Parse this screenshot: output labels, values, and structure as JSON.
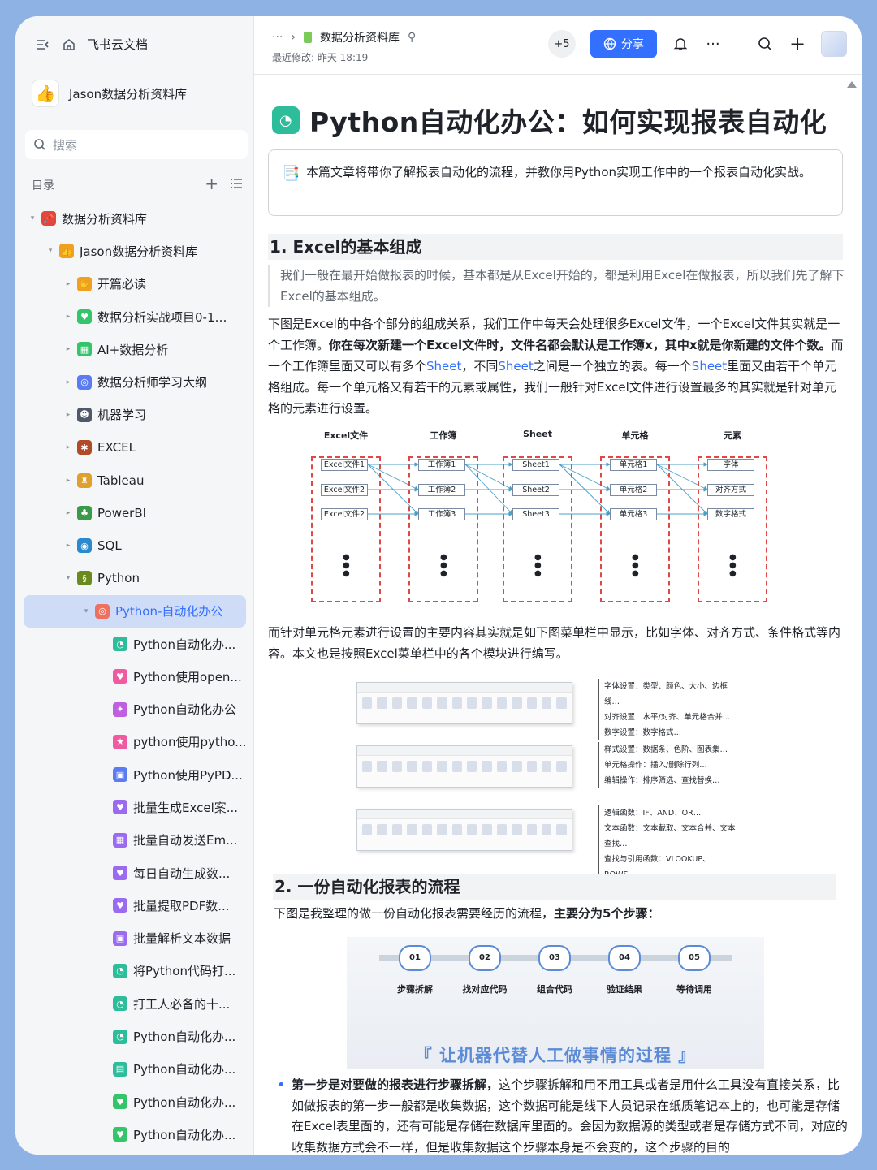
{
  "app": {
    "title": "飞书云文档"
  },
  "sidebar": {
    "space_name": "Jason数据分析资料库",
    "search_placeholder": "搜索",
    "toc_label": "目录",
    "items": [
      {
        "label": "数据分析资料库",
        "level": 0,
        "arrow": "▾",
        "icon": "pin-icon",
        "color": "#e0473e",
        "glyph": "📌"
      },
      {
        "label": "Jason数据分析资料库",
        "level": 1,
        "arrow": "▾",
        "icon": "thumbs-up-icon",
        "color": "#f0a020",
        "glyph": "👍"
      },
      {
        "label": "开篇必读",
        "level": 2,
        "arrow": "▸",
        "icon": "hand-icon",
        "color": "#f0a020",
        "glyph": "✋"
      },
      {
        "label": "数据分析实战项目0-1搭...",
        "level": 2,
        "arrow": "▸",
        "icon": "heart-doc-icon",
        "color": "#34c46a",
        "glyph": "♥"
      },
      {
        "label": "AI+数据分析",
        "level": 2,
        "arrow": "▸",
        "icon": "grid-doc-icon",
        "color": "#34c46a",
        "glyph": "▦"
      },
      {
        "label": "数据分析师学习大纲",
        "level": 2,
        "arrow": "▸",
        "icon": "target-doc-icon",
        "color": "#5b7cf0",
        "glyph": "◎"
      },
      {
        "label": "机器学习",
        "level": 2,
        "arrow": "▸",
        "icon": "robot-icon",
        "color": "#4e5969",
        "glyph": "☻"
      },
      {
        "label": "EXCEL",
        "level": 2,
        "arrow": "▸",
        "icon": "bug-icon",
        "color": "#b24a2a",
        "glyph": "✱"
      },
      {
        "label": "Tableau",
        "level": 2,
        "arrow": "▸",
        "icon": "castle-icon",
        "color": "#e0a030",
        "glyph": "♜"
      },
      {
        "label": "PowerBI",
        "level": 2,
        "arrow": "▸",
        "icon": "palm-tree-icon",
        "color": "#3a9a4a",
        "glyph": "♣"
      },
      {
        "label": "SQL",
        "level": 2,
        "arrow": "▸",
        "icon": "globe-icon",
        "color": "#2a8ad0",
        "glyph": "◉"
      },
      {
        "label": "Python",
        "level": 2,
        "arrow": "▾",
        "icon": "snake-icon",
        "color": "#6a8a20",
        "glyph": "§"
      },
      {
        "label": "Python-自动化办公",
        "level": 3,
        "arrow": "▾",
        "icon": "target-doc-icon",
        "color": "#f07060",
        "glyph": "◎",
        "active": true
      },
      {
        "label": "Python自动化办...",
        "level": 4,
        "arrow": "",
        "icon": "gauge-doc-icon",
        "color": "#2dbd9b",
        "glyph": "◔"
      },
      {
        "label": "Python使用open...",
        "level": 4,
        "arrow": "",
        "icon": "heart-doc-icon",
        "color": "#f05aa0",
        "glyph": "♥"
      },
      {
        "label": "Python自动化办公",
        "level": 4,
        "arrow": "",
        "icon": "sparkle-doc-icon",
        "color": "#c060e0",
        "glyph": "✦"
      },
      {
        "label": "python使用pytho...",
        "level": 4,
        "arrow": "",
        "icon": "star-doc-icon",
        "color": "#f05aa0",
        "glyph": "★"
      },
      {
        "label": "Python使用PyPD...",
        "level": 4,
        "arrow": "",
        "icon": "image-doc-icon",
        "color": "#5b7cf0",
        "glyph": "▣"
      },
      {
        "label": "批量生成Excel案...",
        "level": 4,
        "arrow": "",
        "icon": "heart-doc-icon",
        "color": "#9a6af0",
        "glyph": "♥"
      },
      {
        "label": "批量自动发送Em...",
        "level": 4,
        "arrow": "",
        "icon": "grid-doc-icon",
        "color": "#9a6af0",
        "glyph": "▦"
      },
      {
        "label": "每日自动生成数...",
        "level": 4,
        "arrow": "",
        "icon": "heart-doc-icon",
        "color": "#9a6af0",
        "glyph": "♥"
      },
      {
        "label": "批量提取PDF数...",
        "level": 4,
        "arrow": "",
        "icon": "heart-doc-icon",
        "color": "#9a6af0",
        "glyph": "♥"
      },
      {
        "label": "批量解析文本数据",
        "level": 4,
        "arrow": "",
        "icon": "image-doc-icon",
        "color": "#9a6af0",
        "glyph": "▣"
      },
      {
        "label": "将Python代码打...",
        "level": 4,
        "arrow": "",
        "icon": "gauge-doc-icon",
        "color": "#2dbd9b",
        "glyph": "◔"
      },
      {
        "label": "打工人必备的十...",
        "level": 4,
        "arrow": "",
        "icon": "gauge-doc-icon",
        "color": "#2dbd9b",
        "glyph": "◔"
      },
      {
        "label": "Python自动化办...",
        "level": 4,
        "arrow": "",
        "icon": "gauge-doc-icon",
        "color": "#2dbd9b",
        "glyph": "◔"
      },
      {
        "label": "Python自动化办...",
        "level": 4,
        "arrow": "",
        "icon": "grid-doc-icon",
        "color": "#2dbd9b",
        "glyph": "▤"
      },
      {
        "label": "Python自动化办...",
        "level": 4,
        "arrow": "",
        "icon": "heart-doc-icon",
        "color": "#34c46a",
        "glyph": "♥"
      },
      {
        "label": "Python自动化办...",
        "level": 4,
        "arrow": "",
        "icon": "heart-doc-icon",
        "color": "#34c46a",
        "glyph": "♥"
      }
    ]
  },
  "topbar": {
    "more": "···",
    "breadcrumb": "数据分析资料库",
    "last_modified": "最近修改: 昨天 18:19",
    "collaborators": "+5",
    "share_label": "分享"
  },
  "doc": {
    "title": "Python自动化办公：如何实现报表自动化",
    "callout": "本篇文章将带你了解报表自动化的流程，并教你用Python实现工作中的一个报表自动化实战。",
    "h2_1": "1. Excel的基本组成",
    "quote": "我们一般在最开始做报表的时候，基本都是从Excel开始的，都是利用Excel在做报表，所以我们先了解下Excel的基本组成。",
    "para1_a": "下图是Excel的中各个部分的组成关系，我们工作中每天会处理很多Excel文件，一个Excel文件其实就是一个工作簿。",
    "para1_b": "你在每次新建一个Excel文件时，文件名都会默认是工作簿x，其中x就是你新建的文件个数。",
    "para1_c": "而一个工作簿里面又可以有多个",
    "sheet": "Sheet",
    "para1_d": "，不同",
    "para1_e": "之间是一个独立的表。每一个",
    "para1_f": "里面又由若干个单元格组成。每一个单元格又有若干的元素或属性，我们一般针对Excel文件进行设置最多的其实就是针对单元格的元素进行设置。",
    "diagram": {
      "columns": [
        "Excel文件",
        "工作簿",
        "Sheet",
        "单元格",
        "元素"
      ],
      "col_items": [
        [
          "Excel文件1",
          "Excel文件2",
          "Excel文件2"
        ],
        [
          "工作簿1",
          "工作簿2",
          "工作簿3"
        ],
        [
          "Sheet1",
          "Sheet2",
          "Sheet3"
        ],
        [
          "单元格1",
          "单元格2",
          "单元格3"
        ],
        [
          "字体",
          "对齐方式",
          "数字格式"
        ]
      ]
    },
    "para2": "而针对单元格元素进行设置的主要内容其实就是如下图菜单栏中显示，比如字体、对齐方式、条件格式等内容。本文也是按照Excel菜单栏中的各个模块进行编写。",
    "ribbon_notes": [
      [
        "字体设置：类型、颜色、大小、边框线…",
        "对齐设置：水平/对齐、单元格合并…",
        "数字设置：数字格式…"
      ],
      [
        "样式设置：数据条、色阶、图表集…",
        "单元格操作：插入/删除行列…",
        "编辑操作：排序筛选、查找替换…"
      ],
      [
        "逻辑函数：IF、AND、OR…",
        "文本函数：文本截取、文本合并、文本查找…",
        "查找与引用函数：VLOOKUP、ROWS…"
      ]
    ],
    "h2_2": "2. 一份自动化报表的流程",
    "para3_a": "下图是我整理的做一份自动化报表需要经历的流程，",
    "para3_b": "主要分为5个步骤：",
    "steps": [
      {
        "num": "01",
        "label": "步骤拆解"
      },
      {
        "num": "02",
        "label": "找对应代码"
      },
      {
        "num": "03",
        "label": "组合代码"
      },
      {
        "num": "04",
        "label": "验证结果"
      },
      {
        "num": "05",
        "label": "等待调用"
      }
    ],
    "slogan": "『 让机器代替人工做事情的过程 』",
    "bullet_bold": "第一步是对要做的报表进行步骤拆解，",
    "bullet_text": "这个步骤拆解和用不用工具或者是用什么工具没有直接关系，比如做报表的第一步一般都是收集数据，这个数据可能是线下人员记录在纸质笔记本上的，也可能是存储在Excel表里面的，还有可能是存储在数据库里面的。会因为数据源的类型或者是存储方式不同，对应的收集数据方式会不一样，但是收集数据这个步骤本身是不会变的，这个步骤的目的"
  },
  "colors": {
    "accent": "#3370ff",
    "page_bg": "#8fb2e4",
    "diagram_red": "#e04848"
  }
}
